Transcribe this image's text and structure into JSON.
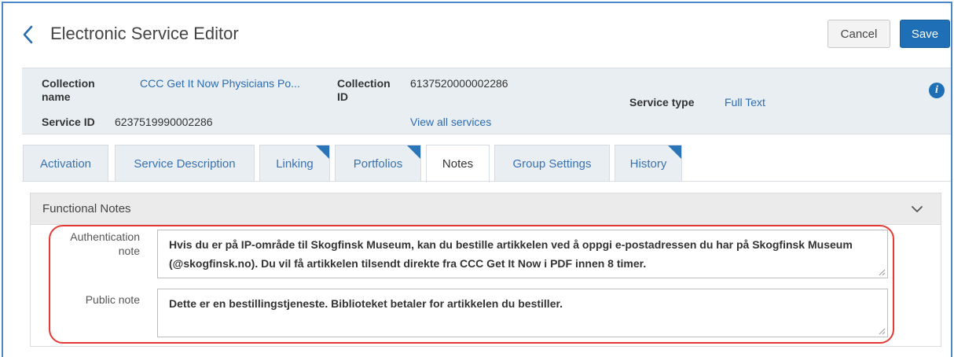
{
  "header": {
    "title": "Electronic Service Editor",
    "cancel_label": "Cancel",
    "save_label": "Save"
  },
  "summary": {
    "collection_name_label": "Collection name",
    "collection_name_value": "CCC Get It Now Physicians Po...",
    "collection_id_label": "Collection ID",
    "collection_id_value": "6137520000002286",
    "service_type_label": "Service type",
    "service_type_value": "Full Text",
    "service_id_label": "Service ID",
    "service_id_value": "6237519990002286",
    "view_all_services": "View all services"
  },
  "tabs": [
    {
      "label": "Activation",
      "active": false,
      "marked": false
    },
    {
      "label": "Service Description",
      "active": false,
      "marked": false
    },
    {
      "label": "Linking",
      "active": false,
      "marked": true
    },
    {
      "label": "Portfolios",
      "active": false,
      "marked": true
    },
    {
      "label": "Notes",
      "active": true,
      "marked": false
    },
    {
      "label": "Group Settings",
      "active": false,
      "marked": false
    },
    {
      "label": "History",
      "active": false,
      "marked": true
    }
  ],
  "panel": {
    "title": "Functional Notes",
    "authentication_note_label": "Authentication note",
    "authentication_note_value": "Hvis du er på IP-område til Skogfinsk Museum, kan du bestille artikkelen ved å oppgi e-postadressen du har på Skogfinsk Museum (@skogfinsk.no). Du vil få artikkelen tilsendt direkte fra CCC Get It Now i PDF innen 8 timer.",
    "public_note_label": "Public note",
    "public_note_value": "Dette er en bestillingstjeneste. Biblioteket betaler for artikkelen du bestiller."
  },
  "colors": {
    "accent": "#1e6fb5",
    "link": "#2b6cb0",
    "highlight": "#e53935"
  }
}
